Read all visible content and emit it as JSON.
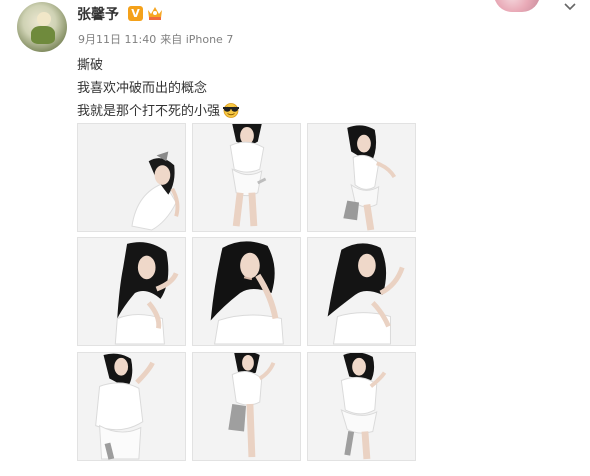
{
  "post": {
    "username": "张馨予",
    "verified_badge": "V",
    "date": "9月11日 11:40",
    "source": "来自 iPhone 7",
    "lines": [
      "撕破",
      "我喜欢冲破而出的概念",
      "我就是那个打不死的小强"
    ],
    "emoji_icon": "sunglasses-emoji-icon",
    "images_count": 9
  },
  "icons": {
    "expand": "chevron-down-icon",
    "vip": "vip-crown-icon"
  },
  "colors": {
    "verified": "#f4a11a",
    "meta_text": "#808080"
  }
}
